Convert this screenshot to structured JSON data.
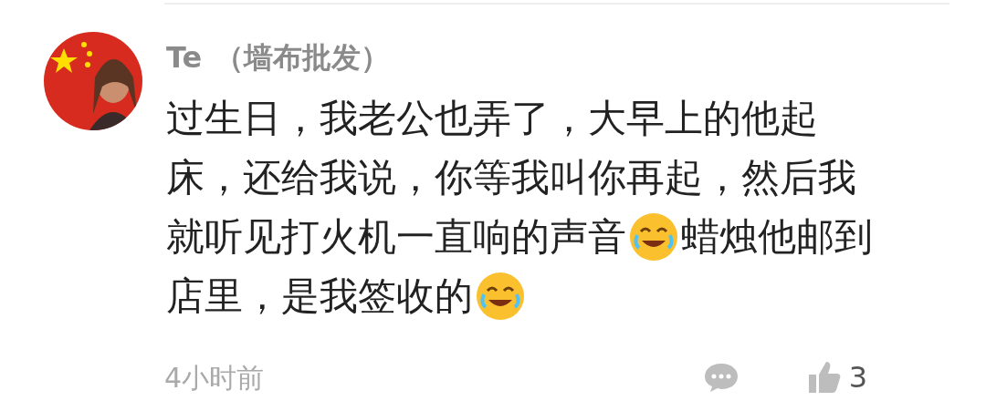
{
  "comment": {
    "author": "Te",
    "tag": "（墙布批发）",
    "lines": [
      [
        {
          "kind": "text",
          "text": "过生日，我老公也弄了，大早上的他起"
        }
      ],
      [
        {
          "kind": "text",
          "text": "床，还给我说，你等我叫你再起，然后我"
        }
      ],
      [
        {
          "kind": "text",
          "text": "就听见打火机一直响的声音"
        },
        {
          "kind": "emoji"
        },
        {
          "kind": "text",
          "text": "蜡烛他邮到"
        }
      ],
      [
        {
          "kind": "text",
          "text": "店里，是我签收的"
        },
        {
          "kind": "emoji"
        }
      ]
    ],
    "time": "4小时前",
    "likes": "3"
  }
}
